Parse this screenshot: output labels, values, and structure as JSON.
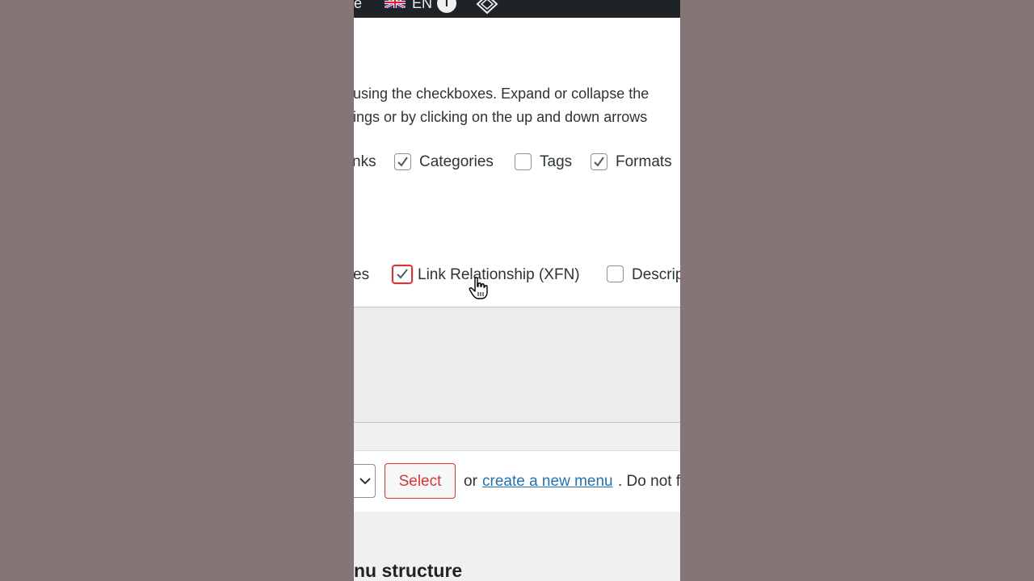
{
  "admin_bar": {
    "left_text": "e",
    "language": "EN",
    "info": "i"
  },
  "screen_options": {
    "description_line1": "using the checkboxes. Expand or collapse the",
    "description_line2": "ings or by clicking on the up and down arrows",
    "boxes_row": [
      {
        "label": "nks",
        "checked": null
      },
      {
        "label": "Categories",
        "checked": true
      },
      {
        "label": "Tags",
        "checked": false
      },
      {
        "label": "Formats",
        "checked": true
      }
    ],
    "advanced_row": [
      {
        "label": "es",
        "checked": null
      },
      {
        "label": "Link Relationship (XFN)",
        "checked": true,
        "focused": true
      },
      {
        "label": "Descrip",
        "checked": false
      }
    ]
  },
  "menu_select": {
    "select_label": "Select",
    "or_text": "or",
    "create_link": "create a new menu",
    "trailing_text": ". Do not f"
  },
  "menu_structure_heading": "nu structure",
  "colors": {
    "admin_bar": "#1d2327",
    "focus_red": "#d63638",
    "link_blue": "#2271b1",
    "outer_background": "#857576"
  }
}
